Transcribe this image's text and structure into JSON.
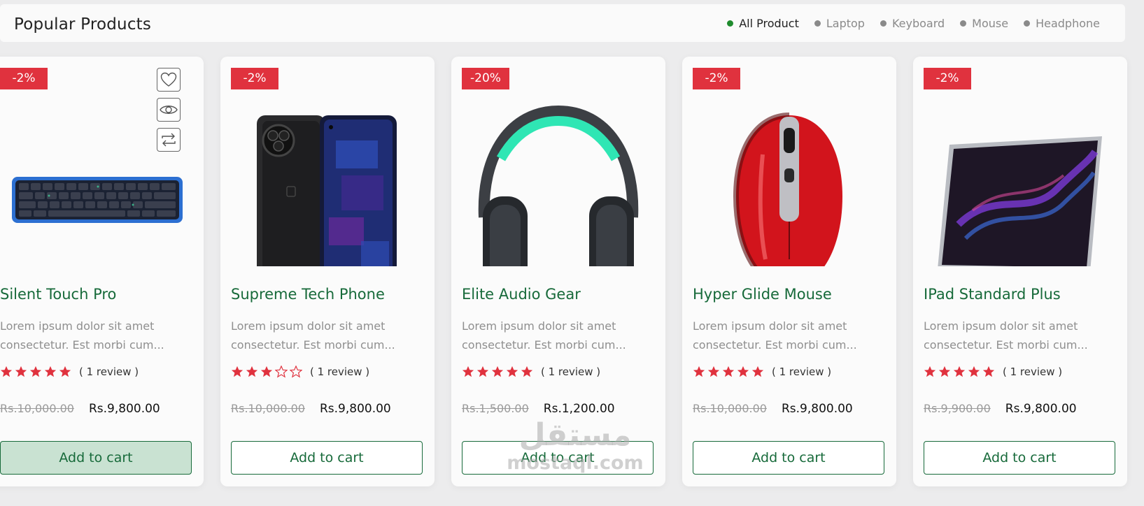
{
  "header": {
    "title": "Popular Products",
    "filters": [
      {
        "label": "All Product",
        "active": true
      },
      {
        "label": "Laptop",
        "active": false
      },
      {
        "label": "Keyboard",
        "active": false
      },
      {
        "label": "Mouse",
        "active": false
      },
      {
        "label": "Headphone",
        "active": false
      }
    ]
  },
  "colors": {
    "accent_green": "#176a3a",
    "badge_red": "#e0323e",
    "star_red": "#e0323e",
    "active_dot": "#1f8b2d"
  },
  "products": [
    {
      "name": "Silent Touch Pro",
      "discount": "-2%",
      "description": "Lorem ipsum dolor sit amet consectetur. Est morbi cum...",
      "rating": 5,
      "reviews": "( 1 review )",
      "old_price": "Rs.10,000.00",
      "new_price": "Rs.9,800.00",
      "button": "Add to cart",
      "image": "keyboard",
      "hovered": true
    },
    {
      "name": "Supreme Tech Phone",
      "discount": "-2%",
      "description": "Lorem ipsum dolor sit amet consectetur. Est morbi cum...",
      "rating": 3,
      "reviews": "( 1 review )",
      "old_price": "Rs.10,000.00",
      "new_price": "Rs.9,800.00",
      "button": "Add to cart",
      "image": "phone",
      "hovered": false
    },
    {
      "name": "Elite Audio Gear",
      "discount": "-20%",
      "description": "Lorem ipsum dolor sit amet consectetur. Est morbi cum...",
      "rating": 5,
      "reviews": "( 1 review )",
      "old_price": "Rs.1,500.00",
      "new_price": "Rs.1,200.00",
      "button": "Add to cart",
      "image": "headphone",
      "hovered": false
    },
    {
      "name": "Hyper Glide Mouse",
      "discount": "-2%",
      "description": "Lorem ipsum dolor sit amet consectetur. Est morbi cum...",
      "rating": 5,
      "reviews": "( 1 review )",
      "old_price": "Rs.10,000.00",
      "new_price": "Rs.9,800.00",
      "button": "Add to cart",
      "image": "mouse",
      "hovered": false
    },
    {
      "name": "IPad Standard Plus",
      "discount": "-2%",
      "description": "Lorem ipsum dolor sit amet consectetur. Est morbi cum...",
      "rating": 5,
      "reviews": "( 1 review )",
      "old_price": "Rs.9,900.00",
      "new_price": "Rs.9,800.00",
      "button": "Add to cart",
      "image": "tablet",
      "hovered": false
    }
  ],
  "card_actions": [
    "heart-icon",
    "eye-icon",
    "compare-icon"
  ],
  "watermark": {
    "arabic": "مستقل",
    "latin": "mostaql.com"
  }
}
